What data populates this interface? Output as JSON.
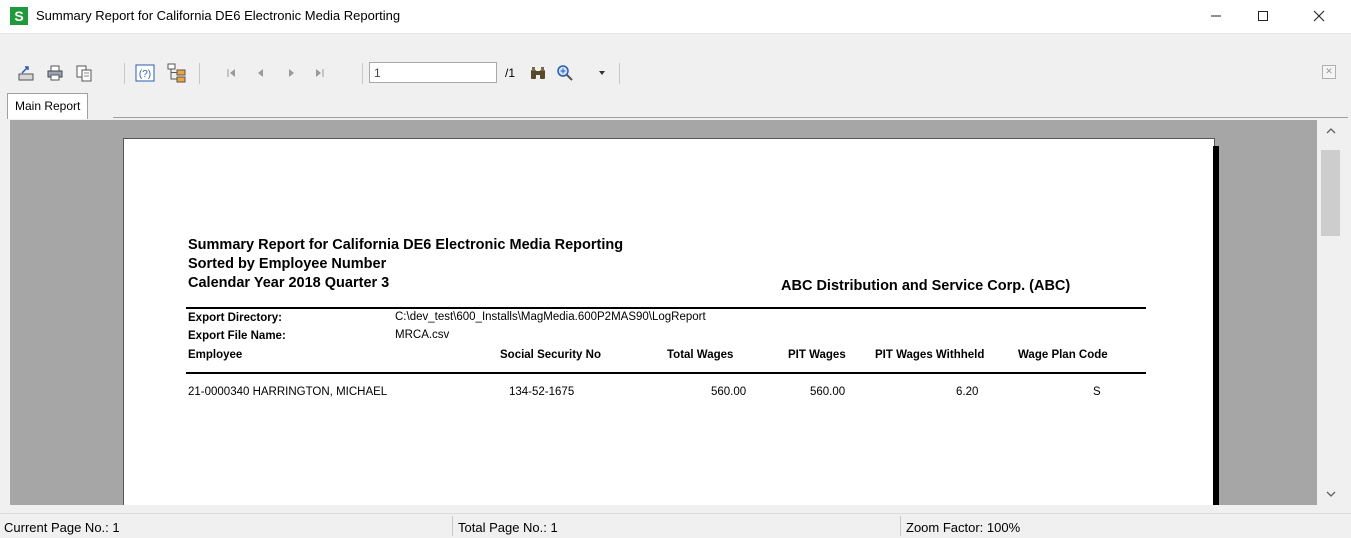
{
  "window": {
    "title": "Summary Report for California DE6 Electronic Media Reporting",
    "app_icon_letter": "S"
  },
  "toolbar": {
    "page_input_value": "1",
    "page_total": "/1"
  },
  "tabs": [
    {
      "label": "Main Report"
    }
  ],
  "report": {
    "title_line1": "Summary Report for California DE6 Electronic Media Reporting",
    "title_line2": "Sorted by Employee Number",
    "title_line3": "Calendar Year 2018 Quarter 3",
    "company": "ABC Distribution and Service Corp. (ABC)",
    "export_directory_label": "Export Directory:",
    "export_directory_value": "C:\\dev_test\\600_Installs\\MagMedia.600P2MAS90\\LogReport",
    "export_file_label": "Export File Name:",
    "export_file_value": "MRCA.csv",
    "columns": {
      "employee": "Employee",
      "ssn": "Social Security No",
      "total_wages": "Total Wages",
      "pit_wages": "PIT Wages",
      "pit_withheld": "PIT Wages Withheld",
      "wage_plan": "Wage Plan Code"
    },
    "rows": [
      {
        "employee": "21-0000340  HARRINGTON, MICHAEL",
        "ssn": "134-52-1675",
        "total_wages": "560.00",
        "pit_wages": "560.00",
        "pit_withheld": "6.20",
        "wage_plan": "S"
      }
    ]
  },
  "status": {
    "current_page": "Current Page No.: 1",
    "total_page": "Total Page No.: 1",
    "zoom": "Zoom Factor: 100%"
  }
}
